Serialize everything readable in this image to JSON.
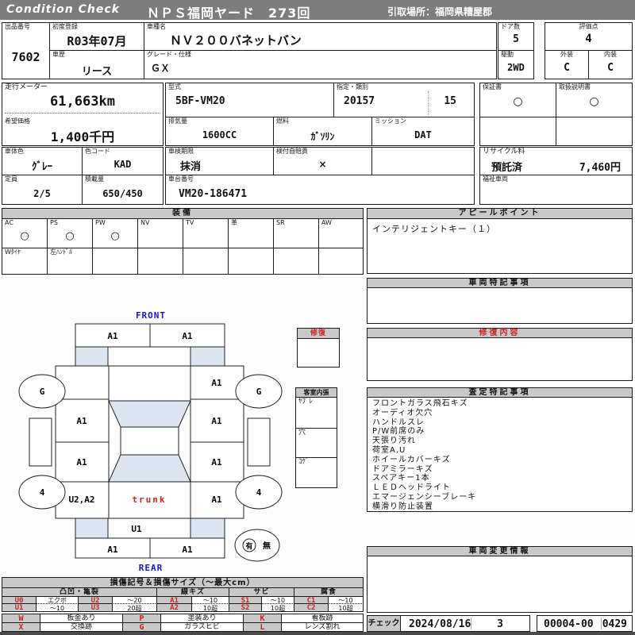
{
  "header": {
    "brand": "Condition Check",
    "title": "ＮＰＳ福岡ヤード　273回",
    "pickup": "引取場所：福岡県糟屋郡"
  },
  "info": {
    "lot_label": "出品番号",
    "lot": "7602",
    "first_reg_label": "初度登録",
    "first_reg": "R03年07月",
    "history_label": "車歴",
    "history": "リース",
    "model_name_label": "車種名",
    "model_name": "ＮＶ２００バネットバン",
    "grade_label": "グレード・仕様",
    "grade": "ＧＸ",
    "doors_label": "ドア数",
    "doors": "5",
    "drive_label": "駆動",
    "drive": "2WD",
    "score_label": "評価点",
    "score": "4",
    "exterior_label": "外装",
    "exterior": "C",
    "interior_label": "内装",
    "interior": "C"
  },
  "specs": {
    "odo_label": "走行メーター",
    "odo": "61,663km",
    "price_label": "希望価格",
    "price": "1,400千円",
    "model_code_label": "型式",
    "model_code": "5BF-VM20",
    "type_label": "指定・類別",
    "type_no": "20157",
    "class_no": "15",
    "displacement_label": "排気量",
    "displacement": "1600CC",
    "fuel_label": "燃料",
    "fuel": "ｶﾞｿﾘﾝ",
    "mission_label": "ミッション",
    "mission": "DAT",
    "warranty_label": "保証書",
    "warranty": "○",
    "manual_label": "取扱説明書",
    "manual": "○"
  },
  "body": {
    "color_label": "車体色",
    "color": "ｸﾞﾚｰ",
    "color_code_label": "色コード",
    "color_code": "KAD",
    "capacity_label": "定員",
    "capacity": "2/5",
    "load_label": "積載量",
    "load": "650/450",
    "inspection_label": "車検期限",
    "inspection": "抹消",
    "insurance_label": "検付自賠責",
    "insurance": "×",
    "chassis_label": "車台番号",
    "chassis": "VM20-186471",
    "recycle_label": "リサイクル料",
    "recycle_status": "預託済",
    "recycle_fee": "7,460円",
    "welfare_label": "福祉車両"
  },
  "equipment": {
    "title": "装備",
    "items": [
      {
        "label": "AC",
        "mark": "○"
      },
      {
        "label": "PS",
        "mark": "○"
      },
      {
        "label": "PW",
        "mark": "○"
      },
      {
        "label": "NV",
        "mark": ""
      },
      {
        "label": "TV",
        "mark": ""
      },
      {
        "label": "革",
        "mark": ""
      },
      {
        "label": "SR",
        "mark": ""
      },
      {
        "label": "AW",
        "mark": ""
      }
    ],
    "items2": [
      {
        "label": "Wﾀｲﾔ",
        "mark": ""
      },
      {
        "label": "左ﾊﾝﾄﾞﾙ",
        "mark": ""
      },
      {
        "label": "",
        "mark": ""
      },
      {
        "label": "",
        "mark": ""
      },
      {
        "label": "",
        "mark": ""
      },
      {
        "label": "",
        "mark": ""
      },
      {
        "label": "",
        "mark": ""
      },
      {
        "label": "",
        "mark": ""
      }
    ]
  },
  "panels": {
    "appeal_title": "アピールポイント",
    "appeal_text": "インテリジェントキー（１）",
    "notes_title": "車両特記事項",
    "repair_title": "修復",
    "repair_detail_title": "修復内容",
    "interior_title": "客室内張",
    "interior_rows": [
      "ﾔﾌﾞﾚ",
      "穴",
      "ｺｹﾞ"
    ],
    "assessment_title": "査定特記事項",
    "assessment_items": [
      "フロントガラス飛石キズ",
      "オーディオ欠穴",
      "ハンドルスレ",
      "P/W前席のみ",
      "天張り汚れ",
      "荷室A,U",
      "ホイールカバーキズ",
      "ドアミラーキズ",
      "スペアキー1本",
      "ＬＥＤヘッドライト",
      "エマージェンシーブレーキ",
      "横滑り防止装置"
    ],
    "change_title": "車両変更情報"
  },
  "diagram": {
    "front_label": "FRONT",
    "rear_label": "REAR",
    "trunk_label": "trunk",
    "front_bumper_left": "A1",
    "front_bumper_right": "A1",
    "rear_bumper_left": "A1",
    "rear_bumper_right": "A1",
    "wheel_fl": "G",
    "wheel_fr": "G",
    "wheel_rl": "4",
    "wheel_rr": "4",
    "left_cells": [
      "",
      "A1",
      "A1",
      "U2,A2"
    ],
    "right_cells": [
      "A1",
      "A1",
      "A1",
      "A1"
    ],
    "rear_panel": "U1",
    "spare_yes": "有",
    "spare_no": "無"
  },
  "legend": {
    "title": "損傷記号＆損傷サイズ（～最大cm）",
    "groups": [
      "凸凹・亀裂",
      "線キズ",
      "サビ",
      "腐食"
    ],
    "row1": [
      {
        "code": "U0",
        "desc": "エクボ"
      },
      {
        "code": "U2",
        "desc": "～20"
      },
      {
        "code": "A1",
        "desc": "～10"
      },
      {
        "code": "S1",
        "desc": "～10"
      },
      {
        "code": "C1",
        "desc": "～10"
      }
    ],
    "row2": [
      {
        "code": "U1",
        "desc": "～10"
      },
      {
        "code": "U3",
        "desc": "20超"
      },
      {
        "code": "A2",
        "desc": "10超"
      },
      {
        "code": "S2",
        "desc": "10超"
      },
      {
        "code": "C2",
        "desc": "10超"
      }
    ],
    "row3": [
      {
        "code": "W",
        "desc": "板金あり"
      },
      {
        "code": "P",
        "desc": "塗装あり"
      },
      {
        "code": "K",
        "desc": "看板跡"
      }
    ],
    "row4": [
      {
        "code": "X",
        "desc": "交換跡"
      },
      {
        "code": "G",
        "desc": "ガラスヒビ"
      },
      {
        "code": "L",
        "desc": "レンズ割れ"
      }
    ]
  },
  "footer": {
    "check_label": "チェック",
    "date": "2024/08/16",
    "count": "3",
    "code": "00004-00",
    "code2": "0429"
  },
  "colors": {
    "accent_red": "#cc2222",
    "accent_blue": "#1515cc",
    "header_gray": "#7d7d7d",
    "panel_gray": "#c9c9c9",
    "window_blue": "#dce6f1"
  }
}
